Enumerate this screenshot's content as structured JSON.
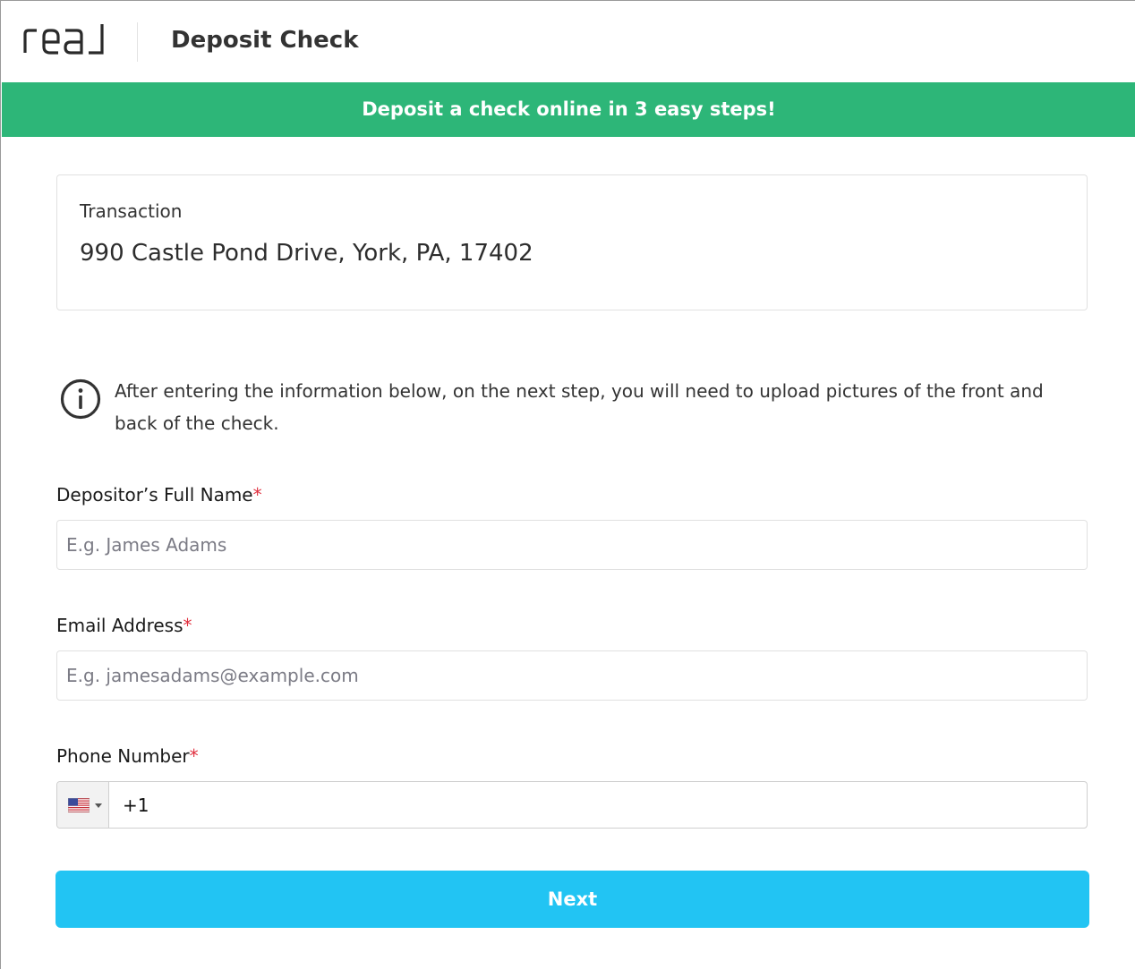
{
  "header": {
    "logo_text": "real",
    "title": "Deposit Check"
  },
  "banner": {
    "text": "Deposit a check online in 3 easy steps!",
    "color": "#2db678"
  },
  "transaction": {
    "label": "Transaction",
    "address": "990 Castle Pond Drive, York, PA, 17402"
  },
  "info": {
    "icon": "info-icon",
    "text": "After entering the information below, on the next step, you will need to upload pictures of the front and back of the check."
  },
  "form": {
    "name": {
      "label": "Depositor’s Full Name",
      "required_mark": "*",
      "value": "",
      "placeholder": "E.g. James Adams"
    },
    "email": {
      "label": "Email Address",
      "required_mark": "*",
      "value": "",
      "placeholder": "E.g. jamesadams@example.com"
    },
    "phone": {
      "label": "Phone Number",
      "required_mark": "*",
      "country_flag": "us-flag-icon",
      "value": "+1"
    },
    "next_label": "Next"
  },
  "colors": {
    "accent": "#22c4f3",
    "required": "#e0303f"
  }
}
